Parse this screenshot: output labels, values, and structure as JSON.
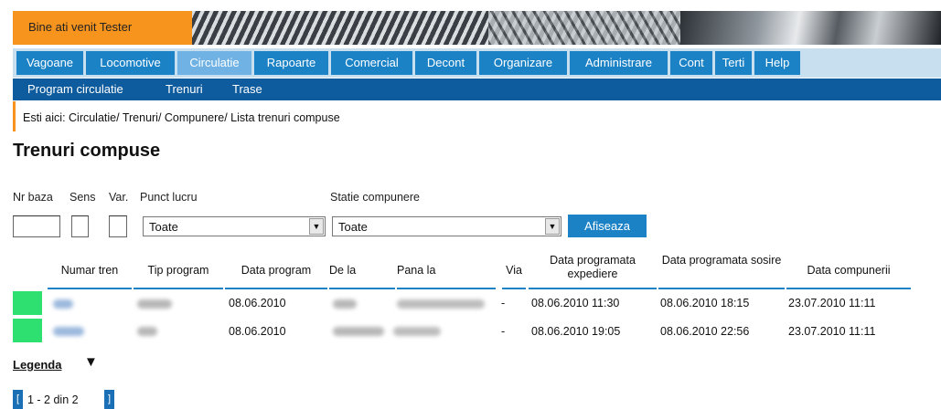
{
  "header": {
    "welcome": "Bine ati venit Tester"
  },
  "menu": [
    "Vagoane",
    "Locomotive",
    "Circulatie",
    "Rapoarte",
    "Comercial",
    "Decont",
    "Organizare",
    "Administrare",
    "Cont",
    "Terti",
    "Help"
  ],
  "menu_active": "Circulatie",
  "submenu": [
    "Program circulatie",
    "Trenuri",
    "Trase"
  ],
  "breadcrumb": "Esti aici: Circulatie/ Trenuri/ Compunere/ Lista trenuri compuse",
  "page_title": "Trenuri compuse",
  "filters": {
    "nr_baza_label": "Nr baza",
    "sens_label": "Sens",
    "var_label": "Var.",
    "punct_lucru_label": "Punct lucru",
    "punct_lucru_value": "Toate",
    "statie_label": "Statie compunere",
    "statie_value": "Toate",
    "button": "Afiseaza"
  },
  "table": {
    "headers": [
      "Numar tren",
      "Tip program",
      "Data program",
      "De la",
      "Pana la",
      "Via",
      "Data programata expediere",
      "Data programata sosire",
      "Data compunerii"
    ],
    "rows": [
      {
        "data_program": "08.06.2010",
        "via": "-",
        "expediere": "08.06.2010 11:30",
        "sosire": "08.06.2010 18:15",
        "compunere": "23.07.2010 11:11"
      },
      {
        "data_program": "08.06.2010",
        "via": "-",
        "expediere": "08.06.2010 19:05",
        "sosire": "08.06.2010 22:56",
        "compunere": "23.07.2010 11:11"
      }
    ]
  },
  "legend": "Legenda",
  "pagination": "1 - 2 din 2",
  "colors": {
    "accent_orange": "#f7941d",
    "menu_blue": "#1b82c6",
    "submenu_blue": "#0e5c9d",
    "status_green": "#2ee06f"
  }
}
